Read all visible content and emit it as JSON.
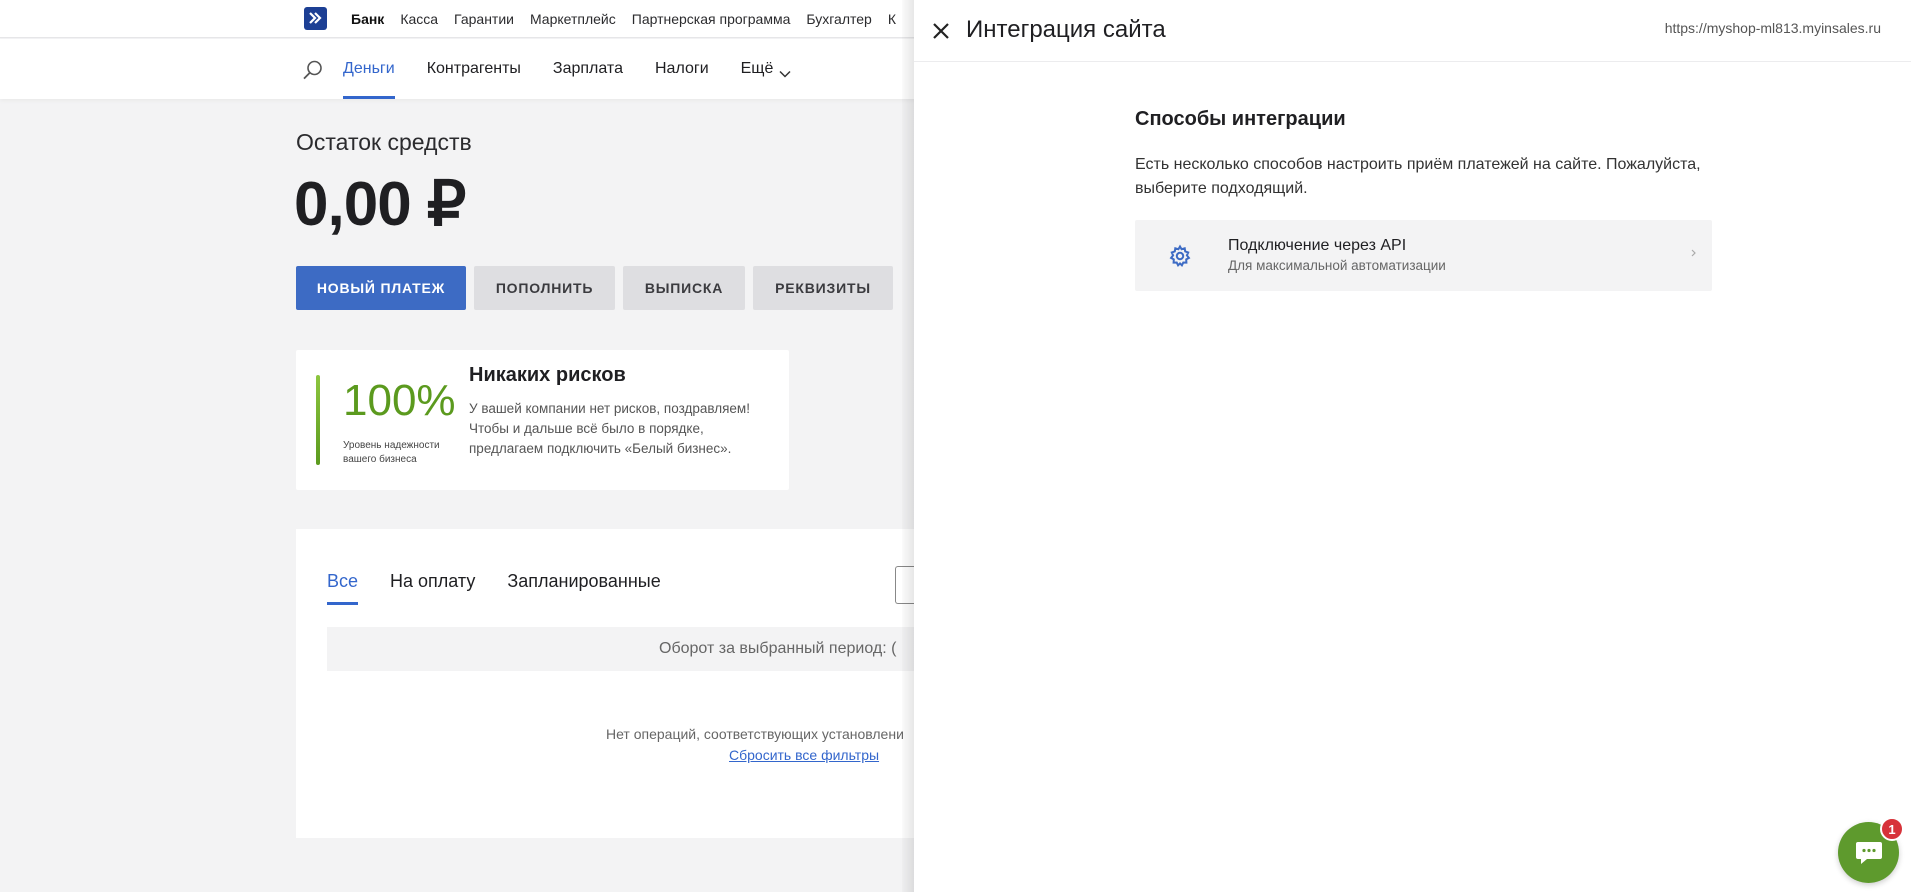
{
  "topnav": {
    "items": [
      {
        "label": "Банк",
        "active": true
      },
      {
        "label": "Касса",
        "active": false
      },
      {
        "label": "Гарантии",
        "active": false
      },
      {
        "label": "Маркетплейс",
        "active": false
      },
      {
        "label": "Партнерская программа",
        "active": false
      },
      {
        "label": "Бухгалтер",
        "active": false
      },
      {
        "label": "К",
        "active": false
      }
    ]
  },
  "subnav": {
    "items": [
      {
        "label": "Деньги",
        "active": true
      },
      {
        "label": "Контрагенты",
        "active": false
      },
      {
        "label": "Зарплата",
        "active": false
      },
      {
        "label": "Налоги",
        "active": false
      },
      {
        "label": "Ещё",
        "active": false
      }
    ]
  },
  "balance": {
    "label": "Остаток средств",
    "value": "0,00 ₽"
  },
  "actions": {
    "new_payment": "НОВЫЙ ПЛАТЕЖ",
    "top_up": "ПОПОЛНИТЬ",
    "statement": "ВЫПИСКА",
    "requisites": "РЕКВИЗИТЫ"
  },
  "risk": {
    "percent": "100%",
    "sublabel": "Уровень надежности вашего бизнеса",
    "title": "Никаких рисков",
    "text": "У вашей компании нет рисков, поздравляем! Чтобы и дальше всё было в порядке, предлагаем подключить «Белый бизнес»."
  },
  "operations": {
    "tabs": [
      {
        "label": "Все",
        "active": true
      },
      {
        "label": "На оплату",
        "active": false
      },
      {
        "label": "Запланированные",
        "active": false
      }
    ],
    "turnover": "Оборот за выбранный период: (",
    "empty": "Нет операций, соответствующих установлени",
    "reset": "Сбросить все фильтры"
  },
  "drawer": {
    "title": "Интеграция сайта",
    "url": "https://myshop-ml813.myinsales.ru",
    "section_title": "Способы интеграции",
    "section_desc": "Есть несколько способов настроить приём платежей на сайте. Пожалуйста, выберите подходящий.",
    "option": {
      "title": "Подключение через API",
      "subtitle": "Для максимальной автоматизации"
    }
  },
  "chat": {
    "badge": "1"
  },
  "colors": {
    "accent": "#3366cc",
    "primary_button": "#3d6bc4",
    "success": "#5b9a1e",
    "chat": "#5e9a2d",
    "badge": "#d7333a"
  }
}
